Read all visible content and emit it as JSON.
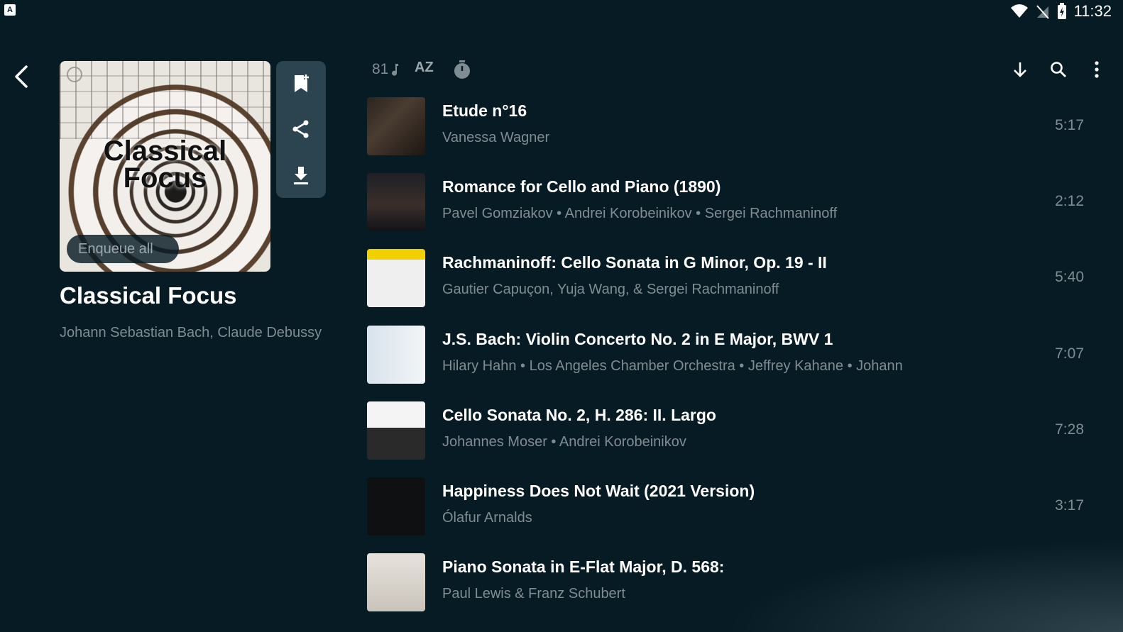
{
  "status_bar": {
    "time": "11:32",
    "left_icon": "A"
  },
  "playlist": {
    "cover_text": "Classical Focus",
    "title": "Classical Focus",
    "subtitle": "Johann Sebastian Bach, Claude Debussy",
    "enqueue_label": "Enqueue all"
  },
  "toolbar": {
    "track_count": "81",
    "sort_label": "AZ"
  },
  "tracks": [
    {
      "title": "Etude n°16",
      "artist": "Vanessa Wagner",
      "duration": "5:17"
    },
    {
      "title": "Romance for Cello and Piano (1890)",
      "artist": "Pavel Gomziakov • Andrei Korobeinikov • Sergei Rachmaninoff",
      "duration": "2:12"
    },
    {
      "title": "Rachmaninoff: Cello Sonata in G Minor, Op. 19 - II",
      "artist": "Gautier Capuçon, Yuja Wang, & Sergei Rachmaninoff",
      "duration": "5:40"
    },
    {
      "title": "J.S. Bach: Violin Concerto No. 2 in E Major, BWV 1",
      "artist": "Hilary Hahn • Los Angeles Chamber Orchestra • Jeffrey Kahane • Johann",
      "duration": "7:07"
    },
    {
      "title": "Cello Sonata No. 2, H. 286: II. Largo",
      "artist": "Johannes Moser • Andrei Korobeinikov",
      "duration": "7:28"
    },
    {
      "title": "Happiness Does Not Wait (2021 Version)",
      "artist": "Ólafur Arnalds",
      "duration": "3:17"
    },
    {
      "title": "Piano Sonata in E-Flat Major, D. 568:",
      "artist": "Paul Lewis & Franz Schubert",
      "duration": ""
    }
  ]
}
